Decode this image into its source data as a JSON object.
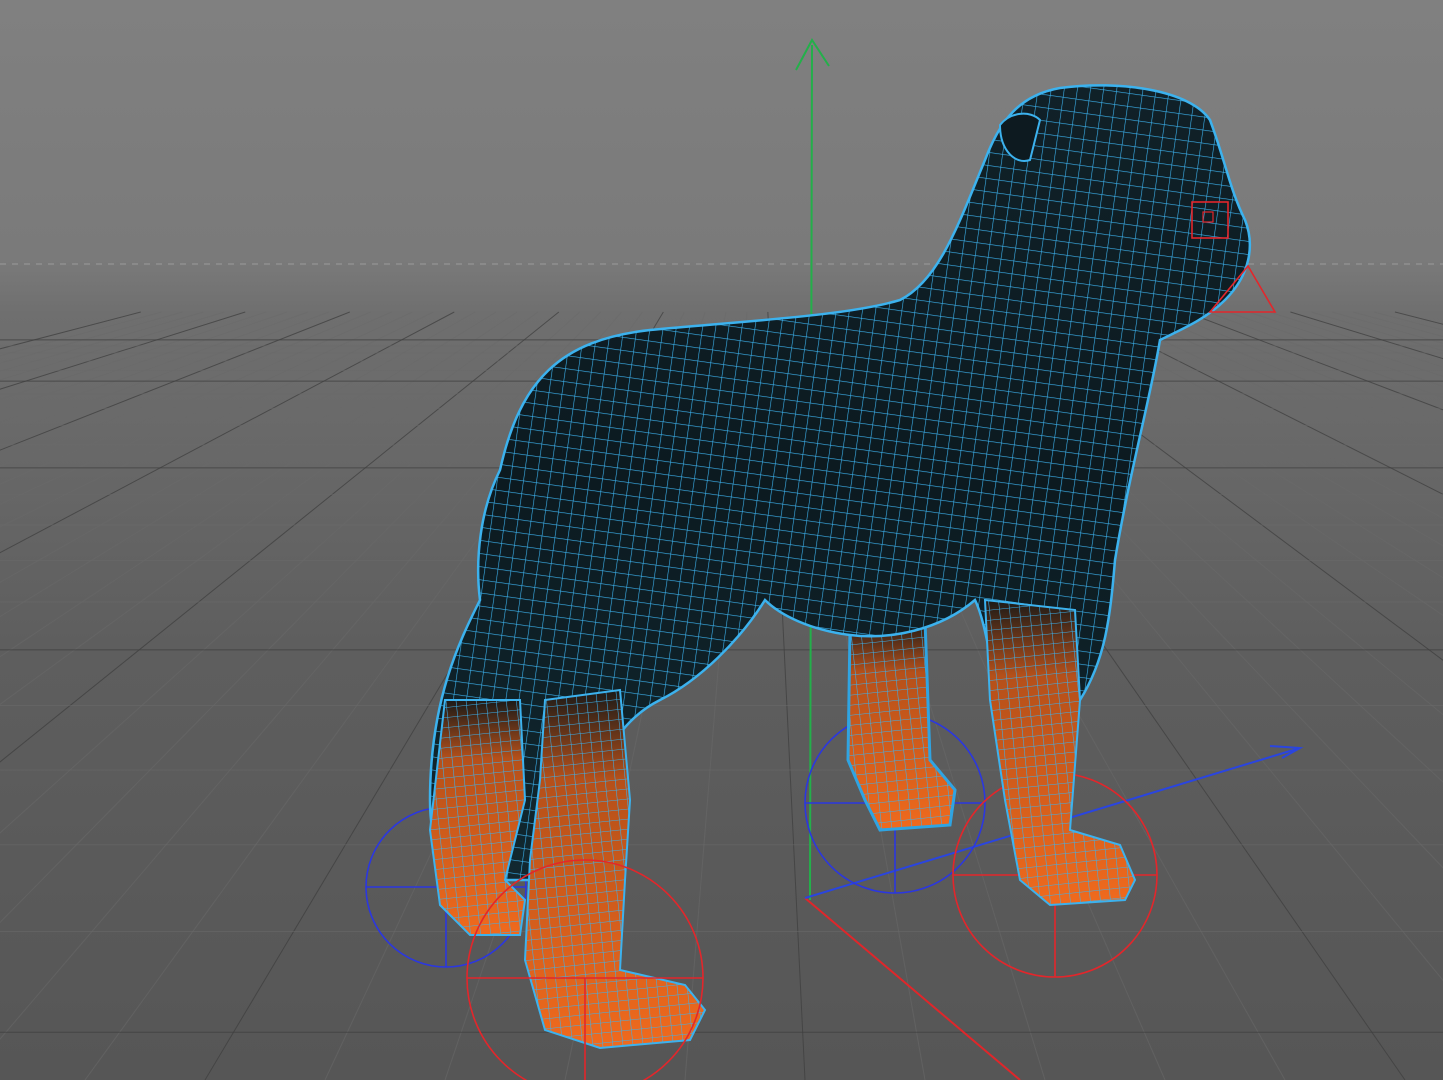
{
  "viewport": {
    "label": "",
    "colors": {
      "background_top": "#808080",
      "background_bottom": "#565656",
      "grid": "#3f3f3f",
      "axis_x": "#e0262a",
      "axis_y": "#23b04a",
      "axis_z": "#2a45e0",
      "wireframe": "#3cb2ee",
      "mesh_body": "#0d1a1f",
      "mesh_paws": "#e8651c"
    },
    "object": {
      "name": "dog-mesh",
      "display_mode": "wireframe-on-shaded",
      "selected": true
    },
    "ik_handles": [
      {
        "id": "front-left-paw",
        "color": "red"
      },
      {
        "id": "front-right-paw",
        "color": "blue"
      },
      {
        "id": "rear-left-paw",
        "color": "red"
      },
      {
        "id": "rear-right-paw",
        "color": "blue"
      }
    ]
  }
}
